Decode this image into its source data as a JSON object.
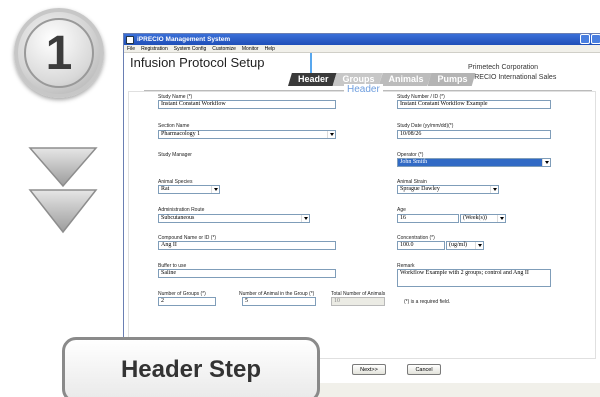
{
  "step_number": "1",
  "step_label": "Header Step",
  "window": {
    "title": "iPRECIO Management System",
    "menu": [
      "File",
      "Registration",
      "System Config",
      "Customize",
      "Monitor",
      "Help"
    ]
  },
  "page_title": "Infusion Protocol Setup",
  "company": {
    "line1": "Primetech Corporation",
    "line2": "iPRECIO International Sales"
  },
  "tabs": [
    "Header",
    "Groups",
    "Animals",
    "Pumps"
  ],
  "section_title": "Header",
  "form": {
    "study_name": {
      "label": "Study Name (*)",
      "value": "Instant Constant Workflow"
    },
    "study_number": {
      "label": "Study Number / ID (*)",
      "value": "Instant Constant Workflow Example"
    },
    "section_name": {
      "label": "Section Name",
      "value": "Pharmacology 1"
    },
    "study_date": {
      "label": "Study Date (yy/mm/dd)(*)",
      "value": "10/08/26"
    },
    "study_manager": {
      "label": "Study Manager"
    },
    "operator": {
      "label": "Operator (*)",
      "value": "John Smith"
    },
    "animal_species": {
      "label": "Animal Species",
      "value": "Rat"
    },
    "animal_strain": {
      "label": "Animal Strain",
      "value": "Sprague Dawley"
    },
    "administration_route": {
      "label": "Administration Route",
      "value": "Subcutaneous"
    },
    "age": {
      "label": "Age",
      "value": "16",
      "unit": "(Week(s))"
    },
    "compound": {
      "label": "Compound Name or ID (*)",
      "value": "Ang II"
    },
    "concentration": {
      "label": "Concentration (*)",
      "value": "100.0",
      "unit": "(ug/ml)"
    },
    "buffer": {
      "label": "Buffer to use",
      "value": "Saline"
    },
    "remark": {
      "label": "Remark",
      "value": "Workflow Example with 2 groups; control and Ang II"
    },
    "num_groups": {
      "label": "Number of Groups (*)",
      "value": "2"
    },
    "num_animals_group": {
      "label": "Number of Animal in the Group (*)",
      "value": "5"
    },
    "total_animals": {
      "label": "Total Number of Animals",
      "value": "10"
    },
    "required_note": "(*) is a required field."
  },
  "buttons": {
    "next": "Next>>",
    "cancel": "Cancel"
  }
}
